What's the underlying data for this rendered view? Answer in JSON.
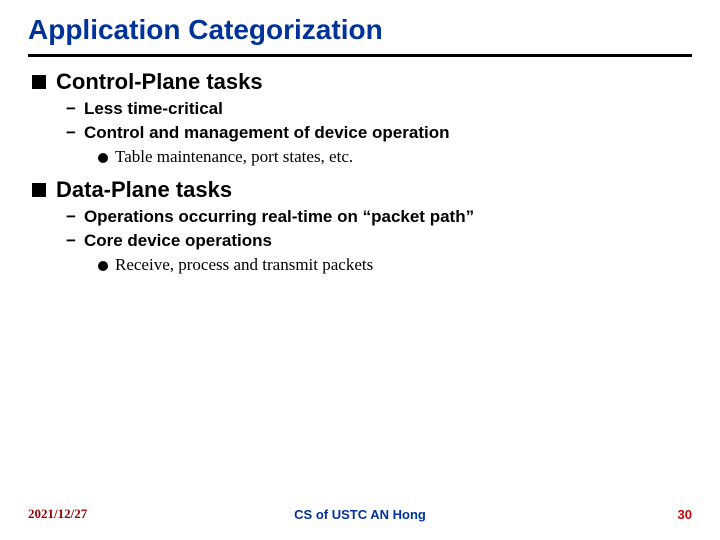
{
  "title": "Application Categorization",
  "sections": [
    {
      "heading": "Control-Plane tasks",
      "items": [
        {
          "text": "Less time-critical"
        },
        {
          "text": "Control and management of device operation",
          "subitems": [
            "Table maintenance, port states, etc."
          ]
        }
      ]
    },
    {
      "heading": "Data-Plane tasks",
      "items": [
        {
          "text": "Operations occurring real-time on “packet path”"
        },
        {
          "text": "Core device operations",
          "subitems": [
            "Receive, process and transmit packets"
          ]
        }
      ]
    }
  ],
  "footer": {
    "date": "2021/12/27",
    "center": "CS of USTC AN Hong",
    "page": "30"
  }
}
